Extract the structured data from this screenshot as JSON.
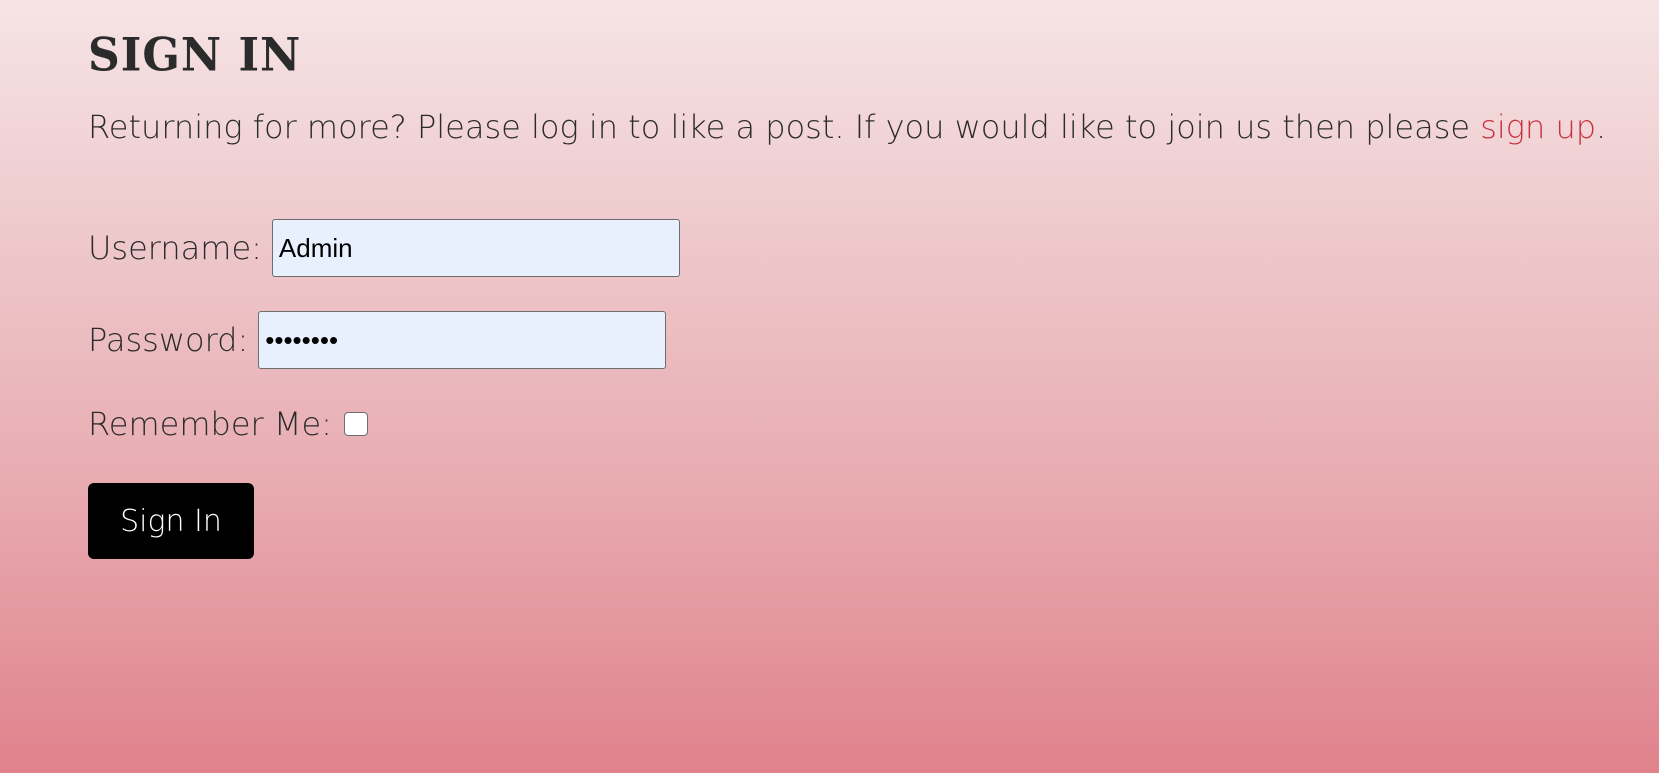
{
  "page": {
    "title": "SIGN IN",
    "intro_text": "Returning for more? Please log in to like a post. If you would like to join us then please ",
    "signup_link": "sign up",
    "intro_end": "."
  },
  "form": {
    "username_label": "Username:",
    "username_value": "Admin",
    "password_label": "Password:",
    "password_value": "••••••••",
    "remember_label": "Remember Me:",
    "remember_checked": false,
    "submit_label": "Sign In"
  },
  "colors": {
    "link": "#c8323f",
    "button_bg": "#000000",
    "input_bg": "#e8f0fe"
  }
}
